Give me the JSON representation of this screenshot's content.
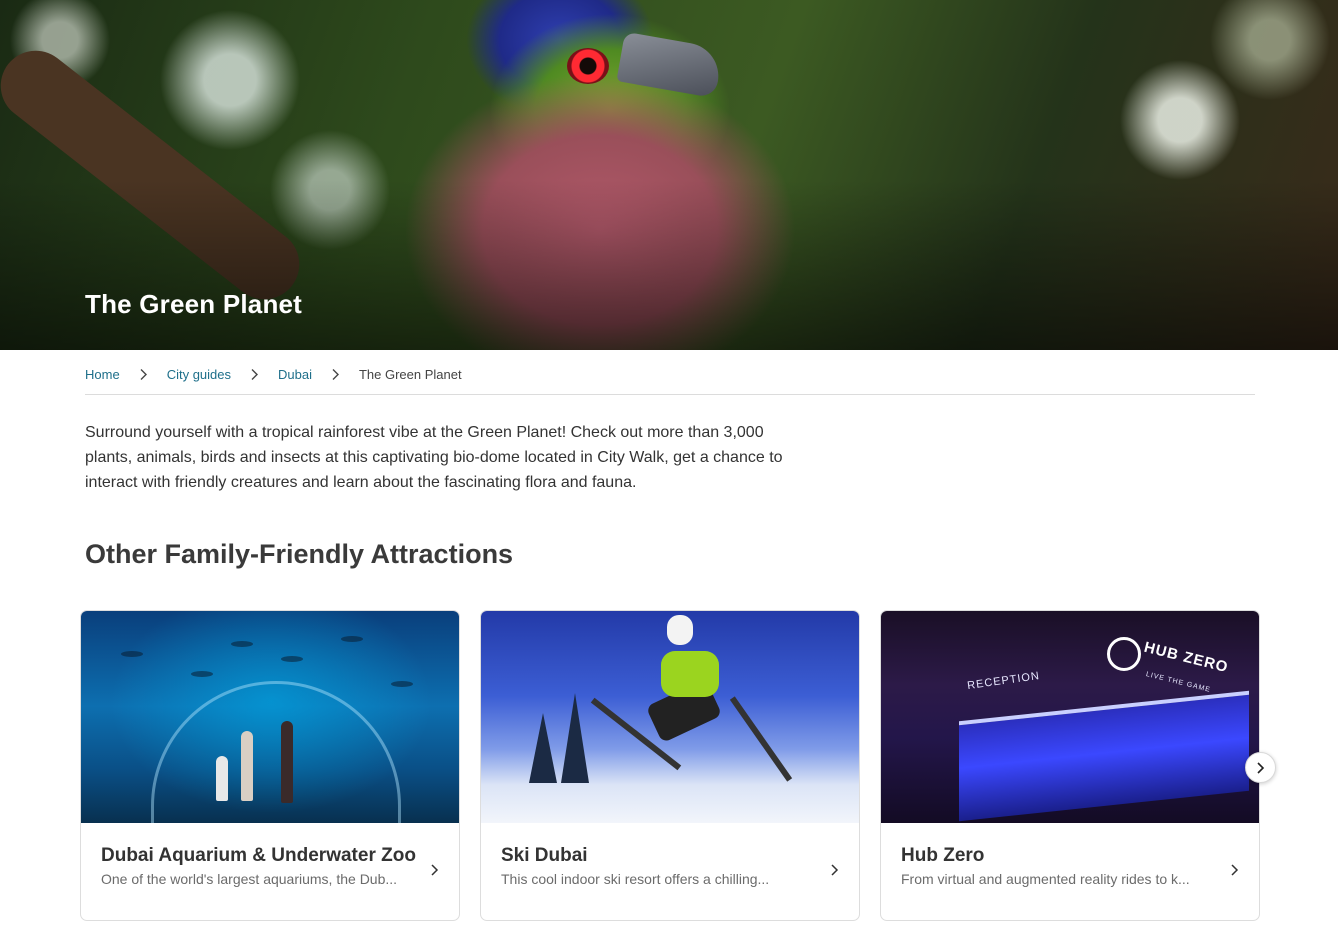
{
  "hero": {
    "title": "The Green Planet",
    "image": "tropical-bird-in-rainforest"
  },
  "breadcrumb": {
    "items": [
      {
        "label": "Home",
        "link": true
      },
      {
        "label": "City guides",
        "link": true
      },
      {
        "label": "Dubai",
        "link": true
      },
      {
        "label": "The Green Planet",
        "link": false
      }
    ],
    "separator_icon": "chevron-right-icon"
  },
  "intro": {
    "text": "Surround yourself with a tropical rainforest vibe at the Green Planet! Check out more than 3,000 plants, animals, birds and insects at this captivating bio-dome located in City Walk, get a chance to interact with friendly creatures and learn about the fascinating flora and fauna."
  },
  "section": {
    "title": "Other Family-Friendly Attractions"
  },
  "cards": [
    {
      "title": "Dubai Aquarium & Underwater Zoo",
      "description": "One of the world's largest aquariums, the Dub...",
      "image": "aquarium-tunnel"
    },
    {
      "title": "Ski Dubai",
      "description": "This cool indoor ski resort offers a chilling...",
      "image": "indoor-ski-jump"
    },
    {
      "title": "Hub Zero",
      "description": "From virtual and augmented reality rides to k...",
      "image": "hub-zero-reception",
      "image_text": {
        "reception": "RECEPTION",
        "logo": "HUB ZERO",
        "tagline": "LIVE THE GAME"
      }
    }
  ],
  "carousel": {
    "next_icon": "chevron-right-icon"
  },
  "colors": {
    "link": "#1e6f8a",
    "text": "#333333",
    "muted": "#6b6b6b",
    "divider": "#dcdcdc"
  }
}
